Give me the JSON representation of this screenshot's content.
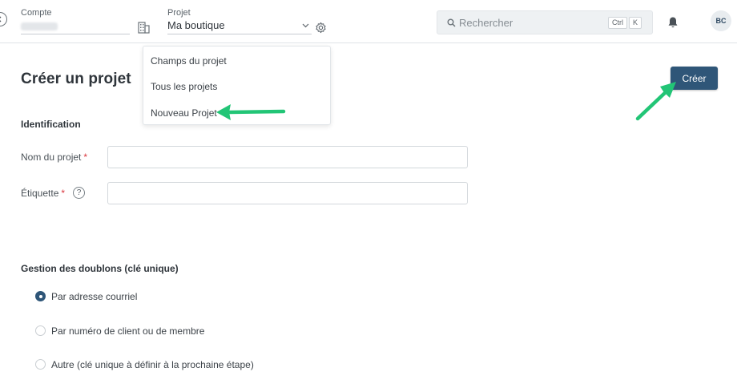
{
  "header": {
    "account": {
      "label": "Compte"
    },
    "project": {
      "label": "Projet",
      "value": "Ma boutique"
    },
    "search": {
      "placeholder": "Rechercher",
      "shortcut_ctrl": "Ctrl",
      "shortcut_key": "K"
    },
    "avatar_initials": "BC"
  },
  "project_menu": {
    "items": [
      {
        "label": "Champs du projet"
      },
      {
        "label": "Tous les projets"
      },
      {
        "label": "Nouveau Projet"
      }
    ]
  },
  "page": {
    "title": "Créer un projet",
    "create_button": "Créer"
  },
  "identification": {
    "title": "Identification",
    "name_label": "Nom du projet",
    "tag_label": "Étiquette",
    "required_mark": "*",
    "help_mark": "?"
  },
  "duplicates": {
    "title": "Gestion des doublons (clé unique)",
    "options": [
      {
        "label": "Par adresse courriel",
        "checked": true
      },
      {
        "label": "Par numéro de client ou de membre",
        "checked": false
      },
      {
        "label": "Autre (clé unique à définir à la prochaine étape)",
        "checked": false
      }
    ]
  },
  "colors": {
    "primary": "#2f5678",
    "annotation_arrow": "#22c576",
    "required": "#d9363e"
  },
  "icons": [
    "back-icon",
    "building-icon",
    "chevron-down-icon",
    "gear-icon",
    "search-icon",
    "bell-icon",
    "help-icon"
  ]
}
